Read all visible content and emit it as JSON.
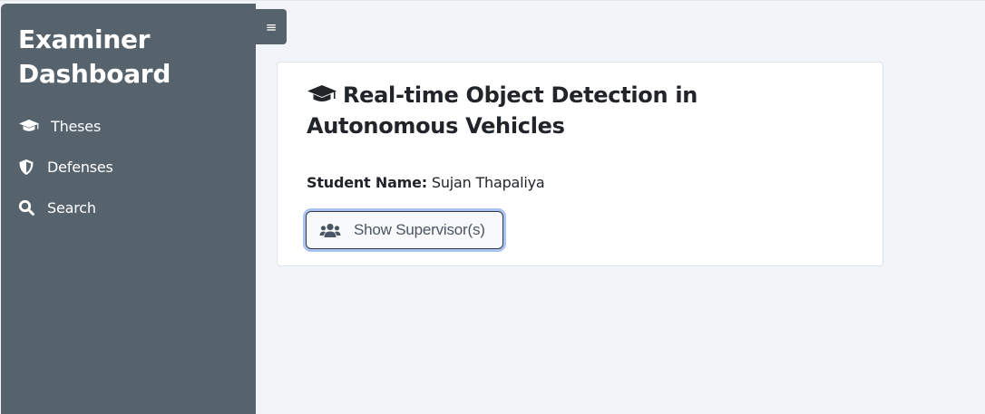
{
  "sidebar": {
    "brand": "Examiner Dashboard",
    "items": [
      {
        "label": "Theses",
        "icon": "graduation-cap-icon"
      },
      {
        "label": "Defenses",
        "icon": "shield-icon"
      },
      {
        "label": "Search",
        "icon": "search-icon"
      }
    ],
    "toggle_icon": "hamburger-icon",
    "toggle_glyph": "≡"
  },
  "thesis": {
    "title": "Real-time Object Detection in Autonomous Vehicles",
    "title_icon": "graduation-cap-icon",
    "student_label": "Student Name:",
    "student_name": "Sujan Thapaliya",
    "supervisor_button": "Show Supervisor(s)",
    "supervisor_icon": "users-icon"
  },
  "colors": {
    "sidebar_bg": "#56636d",
    "page_bg": "#f1f5f9",
    "focus_ring": "#a9c4f2"
  }
}
